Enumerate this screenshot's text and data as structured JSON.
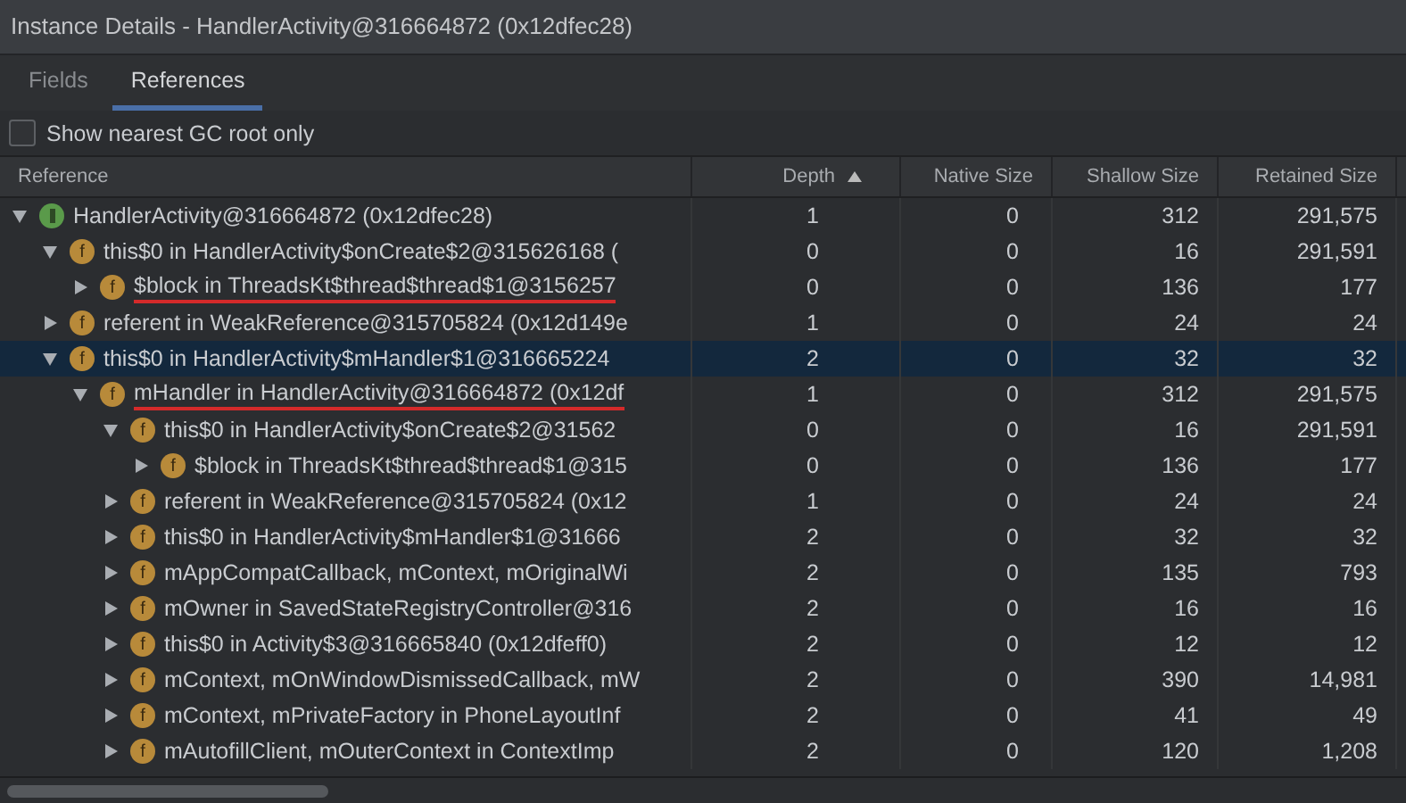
{
  "window": {
    "title": "Instance Details - HandlerActivity@316664872 (0x12dfec28)"
  },
  "tabs": [
    {
      "label": "Fields",
      "selected": false
    },
    {
      "label": "References",
      "selected": true
    }
  ],
  "gc_root_checkbox": {
    "label": "Show nearest GC root only",
    "checked": false
  },
  "table": {
    "columns": [
      {
        "label": "Reference",
        "sorted": false
      },
      {
        "label": "Depth",
        "sorted": true
      },
      {
        "label": "Native Size",
        "sorted": false
      },
      {
        "label": "Shallow Size",
        "sorted": false
      },
      {
        "label": "Retained Size",
        "sorted": false
      }
    ],
    "rows": [
      {
        "kind": "instance",
        "name": "HandlerActivity@316664872 (0x12dfec28)",
        "depth": "1",
        "native": "0",
        "shallow": "312",
        "retained": "291,575",
        "expanded": true,
        "selected": false,
        "underlined": false,
        "children": [
          {
            "kind": "field",
            "icon": "f",
            "name": "this$0 in HandlerActivity$onCreate$2@315626168 (",
            "depth": "0",
            "native": "0",
            "shallow": "16",
            "retained": "291,591",
            "expanded": true,
            "selected": false,
            "underlined": false,
            "children": [
              {
                "kind": "field",
                "icon": "f",
                "name": "$block in ThreadsKt$thread$thread$1@3156257",
                "depth": "0",
                "native": "0",
                "shallow": "136",
                "retained": "177",
                "expanded": false,
                "selected": false,
                "underlined": true
              }
            ]
          },
          {
            "kind": "field",
            "icon": "f",
            "name": "referent in WeakReference@315705824 (0x12d149e",
            "depth": "1",
            "native": "0",
            "shallow": "24",
            "retained": "24",
            "expanded": false,
            "selected": false,
            "underlined": false
          },
          {
            "kind": "field",
            "icon": "f",
            "name": "this$0 in HandlerActivity$mHandler$1@316665224",
            "depth": "2",
            "native": "0",
            "shallow": "32",
            "retained": "32",
            "expanded": true,
            "selected": true,
            "underlined": false,
            "children": [
              {
                "kind": "field",
                "icon": "f",
                "name": "mHandler in HandlerActivity@316664872 (0x12df",
                "depth": "1",
                "native": "0",
                "shallow": "312",
                "retained": "291,575",
                "expanded": true,
                "selected": false,
                "underlined": true,
                "children": [
                  {
                    "kind": "field",
                    "icon": "f",
                    "name": "this$0 in HandlerActivity$onCreate$2@31562",
                    "depth": "0",
                    "native": "0",
                    "shallow": "16",
                    "retained": "291,591",
                    "expanded": true,
                    "selected": false,
                    "underlined": false,
                    "children": [
                      {
                        "kind": "field",
                        "icon": "f",
                        "name": "$block in ThreadsKt$thread$thread$1@315",
                        "depth": "0",
                        "native": "0",
                        "shallow": "136",
                        "retained": "177",
                        "expanded": false,
                        "selected": false,
                        "underlined": false
                      }
                    ]
                  },
                  {
                    "kind": "field",
                    "icon": "f",
                    "name": "referent in WeakReference@315705824 (0x12",
                    "depth": "1",
                    "native": "0",
                    "shallow": "24",
                    "retained": "24",
                    "expanded": false,
                    "selected": false,
                    "underlined": false
                  },
                  {
                    "kind": "field",
                    "icon": "f",
                    "name": "this$0 in HandlerActivity$mHandler$1@31666",
                    "depth": "2",
                    "native": "0",
                    "shallow": "32",
                    "retained": "32",
                    "expanded": false,
                    "selected": false,
                    "underlined": false
                  },
                  {
                    "kind": "field",
                    "icon": "f",
                    "name": "mAppCompatCallback, mContext, mOriginalWi",
                    "depth": "2",
                    "native": "0",
                    "shallow": "135",
                    "retained": "793",
                    "expanded": false,
                    "selected": false,
                    "underlined": false
                  },
                  {
                    "kind": "field",
                    "icon": "f",
                    "name": "mOwner in SavedStateRegistryController@316",
                    "depth": "2",
                    "native": "0",
                    "shallow": "16",
                    "retained": "16",
                    "expanded": false,
                    "selected": false,
                    "underlined": false
                  },
                  {
                    "kind": "field",
                    "icon": "f",
                    "name": "this$0 in Activity$3@316665840 (0x12dfeff0)",
                    "depth": "2",
                    "native": "0",
                    "shallow": "12",
                    "retained": "12",
                    "expanded": false,
                    "selected": false,
                    "underlined": false
                  },
                  {
                    "kind": "field",
                    "icon": "f",
                    "name": "mContext, mOnWindowDismissedCallback, mW",
                    "depth": "2",
                    "native": "0",
                    "shallow": "390",
                    "retained": "14,981",
                    "expanded": false,
                    "selected": false,
                    "underlined": false
                  },
                  {
                    "kind": "field",
                    "icon": "f",
                    "name": "mContext, mPrivateFactory in PhoneLayoutInf",
                    "depth": "2",
                    "native": "0",
                    "shallow": "41",
                    "retained": "49",
                    "expanded": false,
                    "selected": false,
                    "underlined": false
                  },
                  {
                    "kind": "field",
                    "icon": "f",
                    "name": "mAutofillClient, mOuterContext in ContextImp",
                    "depth": "2",
                    "native": "0",
                    "shallow": "120",
                    "retained": "1,208",
                    "expanded": false,
                    "selected": false,
                    "underlined": false
                  }
                ]
              }
            ]
          }
        ]
      }
    ]
  }
}
